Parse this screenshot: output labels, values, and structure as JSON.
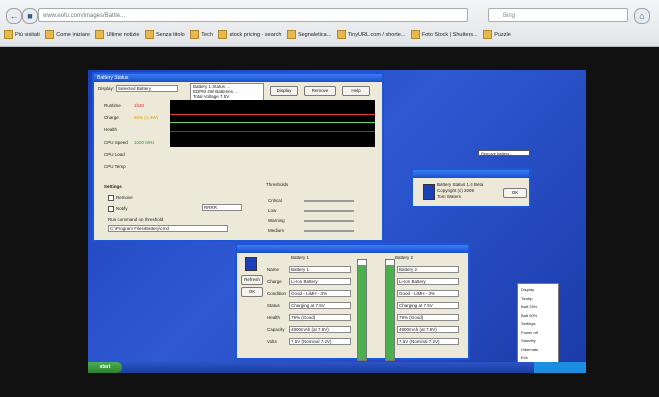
{
  "browser": {
    "url": "www.eofu.com/images/Battle...",
    "search_placeholder": "Bing",
    "bookmarks": [
      "Più visitati",
      "Come iniziare",
      "Ultime notizie",
      "Senza titolo",
      "Tech",
      "stock pricing - search",
      "Segnaletica...",
      "TinyURL.com / shorte...",
      "Foto Stock | Shutters...",
      "Puzzle"
    ]
  },
  "battery_window": {
    "title": "Battery Status",
    "display_label": "Display:",
    "display_value": "Selected Battery",
    "info": [
      "Battery 1 Status ...",
      "EDPM 4W Batteries ...",
      "Total Voltage 7.5V"
    ],
    "buttons": [
      "Display",
      "Remove",
      "Help"
    ],
    "metrics": [
      "Runtime",
      "Charge",
      "Health",
      "CPU Speed",
      "CPU Load",
      "CPU Temp"
    ],
    "metric_values": [
      "1h20",
      "50% (1-4W)",
      "",
      "1000 MHz",
      "",
      ""
    ],
    "settings_label": "Settings",
    "options": [
      "Remove",
      "Notify"
    ],
    "threshold_value": "RRRR",
    "path_label": "Run command on threshold",
    "path_value": "C:\\Program Files\\Battery\\cmd",
    "thresholds_label": "Thresholds",
    "threshold_rows": [
      "Critical",
      "Low",
      "Warning",
      "Medium"
    ]
  },
  "about_window": {
    "title": "",
    "lines": [
      "Battery Status 1.4 Beta",
      "Copyright (c) 2009",
      "Tom Waters"
    ],
    "ok_label": "OK"
  },
  "tooltip": {
    "text": "Remove battery..."
  },
  "details_window": {
    "title": "",
    "side_buttons": [
      "Refresh",
      "OK"
    ],
    "columns": [
      "Battery 1",
      "Battery 2"
    ],
    "rows": [
      {
        "label": "Name",
        "v1": "Battery 1",
        "v2": "Battery 2"
      },
      {
        "label": "Charge",
        "v1": "Li-Ion Battery",
        "v2": "Li-Ion Battery"
      },
      {
        "label": "Condition",
        "v1": "Good - LiMH - 3%",
        "v2": "Good - LiMH - 3%"
      },
      {
        "label": "Status",
        "v1": "Charging at 7.5V",
        "v2": "Charging at 7.5V"
      },
      {
        "label": "Health",
        "v1": "79% (Good)",
        "v2": "79% (Good)"
      },
      {
        "label": "Capacity",
        "v1": "4800mAh (at 7.5V)",
        "v2": "4800mAh (at 7.5V)"
      },
      {
        "label": "Volts",
        "v1": "7.5V (Nominal 7.2V)",
        "v2": "7.5V (Nominal 7.2V)"
      }
    ],
    "battery_levels": [
      0.95,
      0.95
    ]
  },
  "context_menu": {
    "items": [
      "Display",
      "Tooltip",
      "Batt 25%",
      "Batt 50%",
      "Settings",
      "Power off",
      "Standby",
      "Hibernate",
      "Exit"
    ]
  },
  "taskbar": {
    "start_label": "start"
  },
  "colors": {
    "desktop": "#2445c0",
    "title_bar": "#1a4fcf",
    "battery_fill": "#4caf50",
    "graph_line_red": "#e53935",
    "graph_line_green": "#6bd36b"
  }
}
